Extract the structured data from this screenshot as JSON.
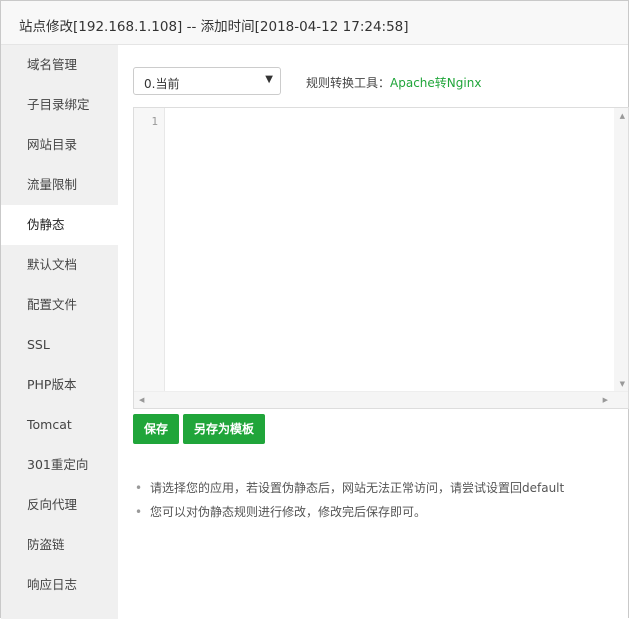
{
  "dialog": {
    "title": "站点修改[192.168.1.108] -- 添加时间[2018-04-12 17:24:58]"
  },
  "sidebar": {
    "items": [
      {
        "label": "域名管理"
      },
      {
        "label": "子目录绑定"
      },
      {
        "label": "网站目录"
      },
      {
        "label": "流量限制"
      },
      {
        "label": "伪静态",
        "active": true
      },
      {
        "label": "默认文档"
      },
      {
        "label": "配置文件"
      },
      {
        "label": "SSL"
      },
      {
        "label": "PHP版本"
      },
      {
        "label": "Tomcat"
      },
      {
        "label": "301重定向"
      },
      {
        "label": "反向代理"
      },
      {
        "label": "防盗链"
      },
      {
        "label": "响应日志"
      }
    ]
  },
  "rewrite": {
    "template_select": {
      "value": "0.当前"
    },
    "tool_label": "规则转换工具：",
    "tool_link": "Apache转Nginx",
    "editor": {
      "line_number": "1",
      "content": ""
    },
    "save_label": "保存",
    "save_as_template_label": "另存为模板",
    "notes": [
      "请选择您的应用，若设置伪静态后，网站无法正常访问，请尝试设置回default",
      "您可以对伪静态规则进行修改，修改完后保存即可。"
    ]
  },
  "colors": {
    "accent": "#20a53a",
    "sidebar_bg": "#f0f0f0",
    "title_bg": "#f8f8f8"
  }
}
